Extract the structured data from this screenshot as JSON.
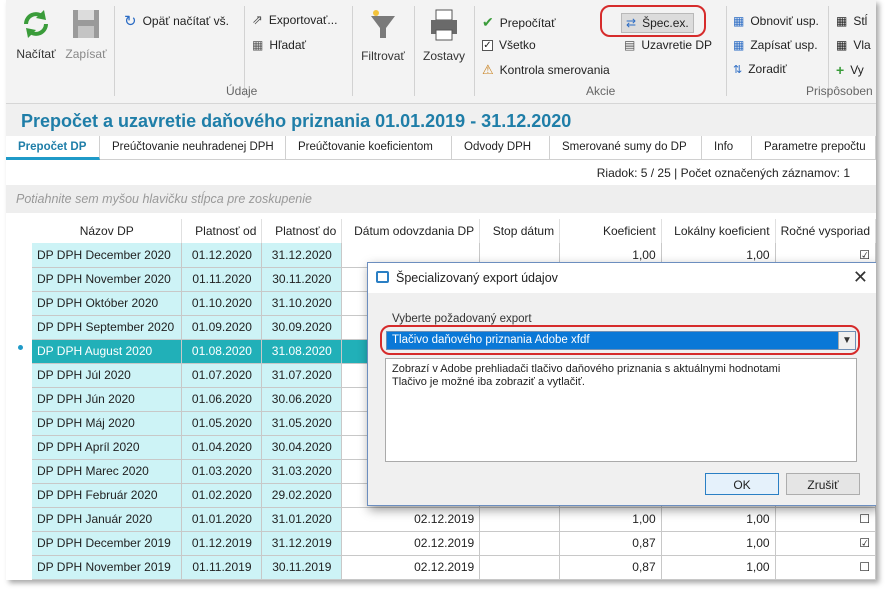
{
  "ribbon": {
    "load": "Načítať",
    "save": "Zapísať",
    "reload_all": "Opäť načítať vš.",
    "export": "Exportovať...",
    "search": "Hľadať",
    "filter": "Filtrovať",
    "reports": "Zostavy",
    "recalc": "Prepočítať",
    "all": "Všetko",
    "routing_check": "Kontrola smerovania",
    "spec_export": "Špec.ex.",
    "close_dp": "Uzavretie DP",
    "refresh": "Obnoviť usp.",
    "write_sort": "Zapísať usp.",
    "sort": "Zoradiť",
    "col_stl": "Stĺ",
    "col_vla": "Vla",
    "col_vy": "Vy",
    "group_data": "Údaje",
    "group_actions": "Akcie",
    "group_customize": "Prispôsoben"
  },
  "page": {
    "title": "Prepočet a uzavretie daňového priznania 01.01.2019 - 31.12.2020",
    "tabs": [
      "Prepočet DP",
      "Preúčtovanie neuhradenej DPH",
      "Preúčtovanie koeficientom",
      "Odvody DPH",
      "Smerované sumy do DP",
      "Info",
      "Parametre prepočtu"
    ],
    "status": "Riadok: 5 / 25 | Počet označených záznamov: 1",
    "group_hint": "Potiahnite sem myšou hlavičku stĺpca pre zoskupenie"
  },
  "grid": {
    "columns": [
      "Názov DP",
      "Platnosť od",
      "Platnosť do",
      "Dátum odovzdania DP",
      "Stop dátum",
      "Koeficient",
      "Lokálny koeficient",
      "Ročné vysporiad"
    ],
    "rows": [
      {
        "name": "DP DPH December 2020",
        "from": "01.12.2020",
        "to": "31.12.2020",
        "submitted": "",
        "stop": "",
        "coef": "1,00",
        "local": "1,00",
        "check": "☑"
      },
      {
        "name": "DP DPH November 2020",
        "from": "01.11.2020",
        "to": "30.11.2020",
        "submitted": "",
        "stop": "",
        "coef": "",
        "local": "",
        "check": ""
      },
      {
        "name": "DP DPH Október 2020",
        "from": "01.10.2020",
        "to": "31.10.2020",
        "submitted": "",
        "stop": "",
        "coef": "",
        "local": "",
        "check": ""
      },
      {
        "name": "DP DPH September 2020",
        "from": "01.09.2020",
        "to": "30.09.2020",
        "submitted": "",
        "stop": "",
        "coef": "",
        "local": "",
        "check": ""
      },
      {
        "name": "DP DPH August 2020",
        "from": "01.08.2020",
        "to": "31.08.2020",
        "submitted": "",
        "stop": "",
        "coef": "",
        "local": "",
        "check": ""
      },
      {
        "name": "DP DPH Júl 2020",
        "from": "01.07.2020",
        "to": "31.07.2020",
        "submitted": "",
        "stop": "",
        "coef": "",
        "local": "",
        "check": ""
      },
      {
        "name": "DP DPH Jún 2020",
        "from": "01.06.2020",
        "to": "30.06.2020",
        "submitted": "",
        "stop": "",
        "coef": "",
        "local": "",
        "check": ""
      },
      {
        "name": "DP DPH Máj 2020",
        "from": "01.05.2020",
        "to": "31.05.2020",
        "submitted": "",
        "stop": "",
        "coef": "",
        "local": "",
        "check": ""
      },
      {
        "name": "DP DPH Apríl 2020",
        "from": "01.04.2020",
        "to": "30.04.2020",
        "submitted": "",
        "stop": "",
        "coef": "",
        "local": "",
        "check": ""
      },
      {
        "name": "DP DPH Marec 2020",
        "from": "01.03.2020",
        "to": "31.03.2020",
        "submitted": "",
        "stop": "",
        "coef": "",
        "local": "",
        "check": ""
      },
      {
        "name": "DP DPH Február 2020",
        "from": "01.02.2020",
        "to": "29.02.2020",
        "submitted": "",
        "stop": "",
        "coef": "",
        "local": "",
        "check": ""
      },
      {
        "name": "DP DPH Január 2020",
        "from": "01.01.2020",
        "to": "31.01.2020",
        "submitted": "02.12.2019",
        "stop": "",
        "coef": "1,00",
        "local": "1,00",
        "check": "☐"
      },
      {
        "name": "DP DPH December 2019",
        "from": "01.12.2019",
        "to": "31.12.2019",
        "submitted": "02.12.2019",
        "stop": "",
        "coef": "0,87",
        "local": "1,00",
        "check": "☑"
      },
      {
        "name": "DP DPH November 2019",
        "from": "01.11.2019",
        "to": "30.11.2019",
        "submitted": "02.12.2019",
        "stop": "",
        "coef": "0,87",
        "local": "1,00",
        "check": "☐"
      }
    ]
  },
  "dialog": {
    "title": "Špecializovaný export údajov",
    "label": "Vyberte požadovaný export",
    "selected": "Tlačivo daňového priznania Adobe xfdf",
    "description_line1": "Zobrazí v Adobe prehliadači tlačivo daňového priznania s aktuálnymi hodnotami",
    "description_line2": "Tlačivo je možné iba zobraziť a vytlačiť.",
    "ok": "OK",
    "cancel": "Zrušiť"
  }
}
